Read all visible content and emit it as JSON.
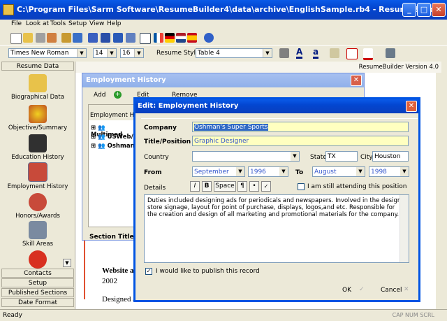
{
  "window": {
    "title": "C:\\Program Files\\Sarm Software\\ResumeBuilder4\\data\\archive\\EnglishSample.rb4 - ResumeBuilder"
  },
  "menu": [
    "File",
    "Look at",
    "Tools",
    "Setup",
    "View",
    "Help"
  ],
  "format": {
    "font": "Times New Roman",
    "size1": "14",
    "size2": "16",
    "style_label": "Resume Style",
    "style_value": "Table 4"
  },
  "sidebar": {
    "header": "Resume Data",
    "items": [
      {
        "label": "Biographical Data",
        "icon": "biographical-icon"
      },
      {
        "label": "Objective/Summary",
        "icon": "objective-icon"
      },
      {
        "label": "Education History",
        "icon": "education-icon"
      },
      {
        "label": "Employment History",
        "icon": "employment-icon"
      },
      {
        "label": "Honors/Awards",
        "icon": "honors-icon"
      },
      {
        "label": "Skill Areas",
        "icon": "skills-icon"
      },
      {
        "label": "",
        "icon": "ribbon-icon"
      }
    ],
    "bottom": [
      "Contacts",
      "Setup",
      "Published Sections",
      "Date Format"
    ]
  },
  "doc": {
    "version": "ResumeBuilder  Version 4.0",
    "lines": [
      "Website a",
      "2002",
      "Designed a"
    ]
  },
  "employment": {
    "title": "Employment History",
    "add_label": "Add",
    "edit_label": "Edit",
    "remove_label": "Remove",
    "list_header": "Employment Histo",
    "entries": [
      "Multimed",
      "USWeb/",
      "Oshman'"
    ],
    "section_title_label": "Section Title"
  },
  "dialog": {
    "title": "Edit:  Employment History",
    "company_label": "Company",
    "company_value": "Oshman's Super Sports",
    "title_label": "Title/Position",
    "title_value": "Graphic Designer",
    "country_label": "Country",
    "country_value": "",
    "state_label": "State",
    "state_value": "TX",
    "city_label": "City",
    "city_value": "Houston",
    "from_label": "From",
    "from_month": "September",
    "from_year": "1996",
    "to_label": "To",
    "to_month": "August",
    "to_year": "1998",
    "details_label": "Details",
    "fmt_i": "I",
    "fmt_b": "B",
    "fmt_space": "Space",
    "fmt_para": "¶",
    "fmt_bullet": "•",
    "attending_label": "I am still attending this position",
    "details_text": [
      "Duties included designing ads for periodicals and newspapers. Involved in the design",
      "store signage, layout for point of purchase, displays, logos,and etc. Responsible for",
      "the creation and design of all marketing and promotional materials for the company."
    ],
    "publish_label": "I would like to publish this record",
    "ok_label": "OK",
    "cancel_label": "Cancel"
  },
  "status": {
    "left": "Ready",
    "indicators": "CAP  NUM  SCRL"
  }
}
